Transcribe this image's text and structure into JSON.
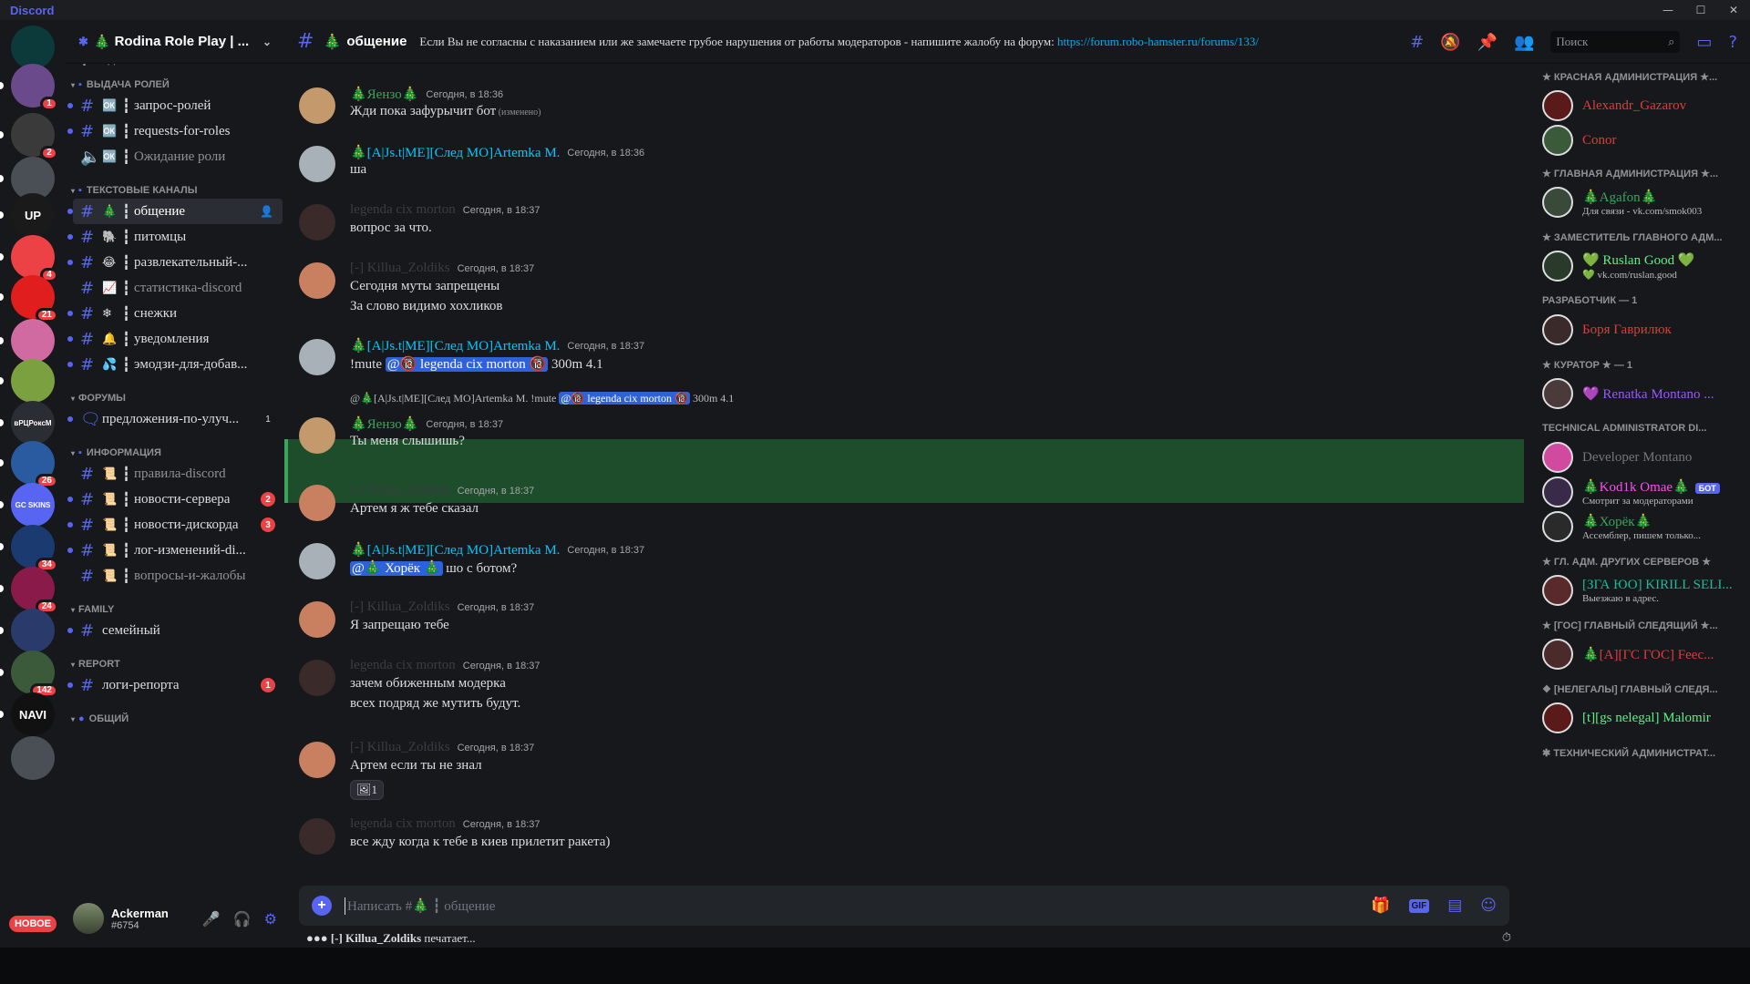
{
  "app": {
    "brand": "Discord"
  },
  "window": {
    "minimize": "—",
    "maximize": "☐",
    "close": "✕"
  },
  "colors": {
    "accent": "#5865f2",
    "danger": "#ed4245",
    "green": "#3ba55c",
    "link": "#00aff4",
    "highlight": "#1e4d2b"
  },
  "servers": [
    {
      "initials": "",
      "color": "#0c3a3a",
      "badge": ""
    },
    {
      "initials": "",
      "color": "#6a4a8a",
      "badge": "1"
    },
    {
      "initials": "",
      "color": "#3a3a3a",
      "badge": "2"
    },
    {
      "initials": "",
      "color": "#4a4f55",
      "badge": ""
    },
    {
      "initials": "UP",
      "color": "#1a1a1a",
      "badge": ""
    },
    {
      "initials": "",
      "color": "#ed4245",
      "badge": "4"
    },
    {
      "initials": "",
      "color": "#e01e1e",
      "badge": "21"
    },
    {
      "initials": "",
      "color": "#d06aa0",
      "badge": ""
    },
    {
      "initials": "",
      "color": "#7aa040",
      "badge": ""
    },
    {
      "initials": "вРЦРоксМ",
      "color": "#2a2d33",
      "badge": ""
    },
    {
      "initials": "",
      "color": "#2a5aa0",
      "badge": "26"
    },
    {
      "initials": "GC SKINS",
      "color": "#5865f2",
      "badge": ""
    },
    {
      "initials": "",
      "color": "#1a3a70",
      "badge": "34"
    },
    {
      "initials": "",
      "color": "#8a1a4a",
      "badge": "24"
    },
    {
      "initials": "",
      "color": "#2a3a6a",
      "badge": ""
    },
    {
      "initials": "",
      "color": "#3a5a3a",
      "badge": "142"
    },
    {
      "initials": "NAVI",
      "color": "#111111",
      "badge": ""
    },
    {
      "initials": "",
      "color": "#4a4f55",
      "badge": ""
    }
  ],
  "new_label": "НОВОЕ",
  "guild": {
    "name": "Rodina Role Play | ...",
    "tree": "🎄"
  },
  "channels": {
    "top_partial": "┇ Подкасты",
    "cat_roles": "ВЫДАЧА РОЛЕЙ",
    "roles": [
      {
        "emo": "🆗",
        "name": "запрос-ролей",
        "muted": false
      },
      {
        "emo": "🆗",
        "name": "requests-for-roles",
        "muted": false
      },
      {
        "emo": "🆗",
        "name": "Ожидание роли",
        "muted": true
      }
    ],
    "cat_text": "ТЕКСТОВЫЕ КАНАЛЫ",
    "text": [
      {
        "emo": "🎄",
        "name": "общение",
        "muted": false
      },
      {
        "emo": "🐘",
        "name": "питомцы",
        "muted": false
      },
      {
        "emo": "😂",
        "name": "развлекательный-...",
        "muted": false
      },
      {
        "emo": "📈",
        "name": "статистика-discord",
        "muted": true
      },
      {
        "emo": "❄",
        "name": "снежки",
        "muted": false
      },
      {
        "emo": "🔔",
        "name": "уведомления",
        "muted": false
      },
      {
        "emo": "💦",
        "name": "эмодзи-для-добав...",
        "muted": false
      }
    ],
    "cat_forums": "ФОРУМЫ",
    "forum": {
      "name": "предложения-по-улуч...",
      "count": "1"
    },
    "cat_info": "ИНФОРМАЦИЯ",
    "info": [
      {
        "emo": "📜",
        "name": "правила-discord",
        "muted": true,
        "count": ""
      },
      {
        "emo": "📜",
        "name": "новости-сервера",
        "muted": false,
        "count": "2"
      },
      {
        "emo": "📜",
        "name": "новости-дискорда",
        "muted": false,
        "count": "3"
      },
      {
        "emo": "📜",
        "name": "лог-изменений-di...",
        "muted": false,
        "count": ""
      },
      {
        "emo": "📜",
        "name": "вопросы-и-жалобы",
        "muted": true,
        "count": ""
      }
    ],
    "cat_family": "FAMILY",
    "family": {
      "name": "семейный"
    },
    "cat_report": "REPORT",
    "report": {
      "name": "логи-репорта",
      "count": "1"
    },
    "cat_general": "ОБЩИЙ"
  },
  "user": {
    "name": "Ackerman",
    "tag": "#6754"
  },
  "topbar": {
    "channel": "общение",
    "topic": "Если Вы не согласны с наказанием или же замечаете грубое нарушения от работы модераторов - напишите жалобу на форум: ",
    "link": "https://forum.robo-hamster.ru/forums/133/",
    "search_placeholder": "Поиск"
  },
  "messages": [
    {
      "author": "🎄Яензо🎄",
      "color": "#3ba55c",
      "time": "Сегодня, в 18:36",
      "lines": [
        "Жди пока зафурычит бот"
      ],
      "edited": "(изменено)"
    },
    {
      "author": "🎄[A|Js.t|ME][След МО]Artemka M.",
      "color": "#00c8ff",
      "time": "Сегодня, в 18:36",
      "lines": [
        "ша"
      ]
    },
    {
      "author": "legenda cix morton",
      "color": "#3a3d44",
      "time": "Сегодня, в 18:37",
      "lines": [
        "вопрос за что."
      ]
    },
    {
      "author": "[-] Killua_Zoldiks",
      "color": "#3a3d44",
      "time": "Сегодня, в 18:37",
      "lines": [
        "Сегодня муты запрещены",
        "За слово видимо хохликов"
      ]
    },
    {
      "author": "🎄[A|Js.t|ME][След МО]Artemka M.",
      "color": "#00c8ff",
      "time": "Сегодня, в 18:37",
      "pre": "!mute ",
      "mention": "@🔞 legenda cix morton 🔞",
      "post": " 300m 4.1"
    },
    {
      "author": "🎄Яензо🎄",
      "color": "#3ba55c",
      "time": "Сегодня, в 18:37",
      "reply": "@🎄[A|Js.t|ME][След МО]Artemka M.  !mute ",
      "reply_mention": "@🔞 legenda cix morton 🔞",
      "reply_post": " 300m 4.1",
      "lines": [
        "Ты меня слышишь?"
      ]
    },
    {
      "author": "[-] Killua_Zoldiks",
      "color": "#3a3d44",
      "time": "Сегодня, в 18:37",
      "lines": [
        "Артем я ж тебе сказал"
      ]
    },
    {
      "author": "🎄[A|Js.t|ME][След МО]Artemka M.",
      "color": "#00c8ff",
      "time": "Сегодня, в 18:37",
      "mention": "@🎄 Хорёк 🎄",
      "post": " шо с ботом?"
    },
    {
      "author": "[-] Killua_Zoldiks",
      "color": "#3a3d44",
      "time": "Сегодня, в 18:37",
      "lines": [
        "Я запрещаю тебе"
      ]
    },
    {
      "author": "legenda cix morton",
      "color": "#3a3d44",
      "time": "Сегодня, в 18:37",
      "lines": [
        "зачем обиженным модерка",
        "всех подряд же мутить будут."
      ]
    },
    {
      "author": "[-] Killua_Zoldiks",
      "color": "#3a3d44",
      "time": "Сегодня, в 18:37",
      "lines": [
        "Артем если ты не знал"
      ],
      "reaction": "1"
    },
    {
      "author": "legenda cix morton",
      "color": "#3a3d44",
      "time": "Сегодня, в 18:37",
      "lines": [
        "все жду когда к тебе в киев прилетит ракета)"
      ]
    }
  ],
  "composer": {
    "placeholder": "Написать #🎄 ┇ общение",
    "gif": "GIF"
  },
  "typing": {
    "who": "[-] Killua_Zoldiks",
    "text": " печатает..."
  },
  "members": [
    {
      "cat": "★ КРАСНАЯ АДМИНИСТРАЦИЯ ★...",
      "items": [
        {
          "name": "Alexandr_Gazarov",
          "color": "#e03c3c",
          "status": ""
        },
        {
          "name": "Conor",
          "color": "#e03c3c",
          "status": ""
        }
      ]
    },
    {
      "cat": "★ ГЛАВНАЯ АДМИНИСТРАЦИЯ ★...",
      "items": [
        {
          "name": "🎄Agafon🎄",
          "color": "#3ba55c",
          "status": "Для связи - vk.com/smok003"
        }
      ]
    },
    {
      "cat": "★ ЗАМЕСТИТЕЛЬ ГЛАВНОГО АДМ...",
      "items": [
        {
          "name": "💚 Ruslan Good 💚",
          "color": "#57f287",
          "status": "💚 vk.com/ruslan.good"
        }
      ]
    },
    {
      "cat": "РАЗРАБОТЧИК — 1",
      "items": [
        {
          "name": "Боря Гаврилюк",
          "color": "#e03c3c",
          "status": ""
        }
      ]
    },
    {
      "cat": "★ КУРАТОР ★ — 1",
      "items": [
        {
          "name": "💜 Renatka Montano ...",
          "color": "#9b59f6",
          "status": ""
        }
      ]
    },
    {
      "cat": "TECHNICAL ADMINISTRATOR DI...",
      "items": [
        {
          "name": "Developer Montano",
          "color": "#72767d",
          "status": ""
        },
        {
          "name": "🎄Kod1k Omae🎄",
          "color": "#ff4df0",
          "status": "Смотрит за модераторами",
          "bot": "БОТ"
        },
        {
          "name": "🎄Хорёк🎄",
          "color": "#3ba55c",
          "status": "Ассемблер, пишем только..."
        }
      ]
    },
    {
      "cat": "★ ГЛ. АДМ. ДРУГИХ СЕРВЕРОВ ★",
      "items": [
        {
          "name": "[ЗГА ЮО] KIRILL SELI...",
          "color": "#1abc9c",
          "status": "Выезжаю в адрес."
        }
      ]
    },
    {
      "cat": "★ [ГОС] ГЛАВНЫЙ СЛЕДЯЩИЙ ★...",
      "items": [
        {
          "name": "🎄[А][ГС ГОС] Feec...",
          "color": "#e03c3c",
          "status": ""
        }
      ]
    },
    {
      "cat": "❖ [НЕЛЕГАЛЫ] ГЛАВНЫЙ СЛЕДЯ...",
      "items": [
        {
          "name": "[t][gs nelegal] Malomir",
          "color": "#57f287",
          "status": ""
        }
      ]
    },
    {
      "cat": "✱ ТЕХНИЧЕСКИЙ АДМИНИСТРАТ...",
      "items": []
    }
  ]
}
